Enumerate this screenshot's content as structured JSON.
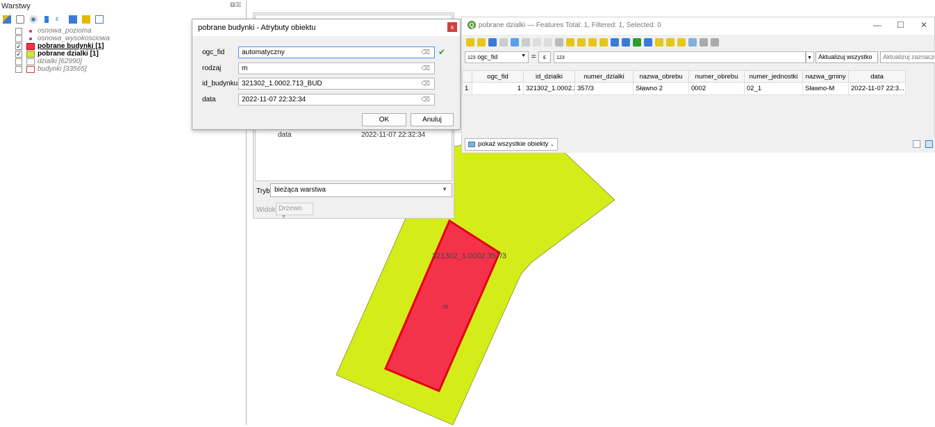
{
  "layers_panel": {
    "title": "Warstwy",
    "layers": [
      {
        "name": "osnowa_pozioma",
        "checked": false,
        "style": "italic",
        "symbol": "point"
      },
      {
        "name": "osnowa_wysokosciowa",
        "checked": false,
        "style": "italic",
        "symbol": "point"
      },
      {
        "name": "pobrane budynki [1]",
        "checked": true,
        "style": "bold-underline",
        "symbol": "red-edit"
      },
      {
        "name": "pobrane dzialki [1]",
        "checked": true,
        "style": "bold",
        "symbol": "yellow-edit"
      },
      {
        "name": "dzialki [62990]",
        "checked": false,
        "style": "italic",
        "symbol": "empty"
      },
      {
        "name": "budynki [33565]",
        "checked": false,
        "style": "italic",
        "symbol": "empty-red"
      }
    ]
  },
  "identify_panel": {
    "row_label": "data",
    "row_value": "2022-11-07 22:32:34",
    "mode_label": "Tryb",
    "mode_value": "bieżąca warstwa",
    "view_label": "Widok",
    "view_value": "Drzewo"
  },
  "dialog": {
    "title": "pobrane budynki - Atrybuty obiektu",
    "fields": [
      {
        "label": "ogc_fid",
        "value": "automatyczny"
      },
      {
        "label": "rodzaj",
        "value": "m"
      },
      {
        "label": "id_budynku",
        "value": "321302_1.0002.713_BUD"
      },
      {
        "label": "data",
        "value": "2022-11-07 22:32:34"
      }
    ],
    "ok_label": "OK",
    "cancel_label": "Anuluj"
  },
  "attr_table": {
    "title": "pobrane dzialki — Features Total: 1, Filtered: 1, Selected: 0",
    "field_select": "ogc_fid",
    "field_prefix": "123",
    "operator": "=",
    "expr_symbol": "ε",
    "value_hint": "123",
    "update_all": "Aktualizuj wszystko",
    "update_selected": "Aktualizuj zaznaczone",
    "columns": [
      "ogc_fid",
      "id_dzialki",
      "numer_dzialki",
      "nazwa_obrebu",
      "numer_obrebu",
      "numer_jednostki",
      "nazwa_gminy",
      "data"
    ],
    "rows": [
      {
        "num": "1",
        "cells": [
          "1",
          "321302_1.0002.3...",
          "357/3",
          "Sławno 2",
          "0002",
          "02_1",
          "Sławno-M",
          "2022-11-07 22:3..."
        ]
      }
    ],
    "show_all": "pokaż wszystkie obiekty"
  },
  "map": {
    "parcel_label": "321302_1.0002.357/3",
    "building_label": "m",
    "parcel_color": "#d4ec1a",
    "building_color": "#f4334a",
    "building_border": "#e3000f"
  }
}
